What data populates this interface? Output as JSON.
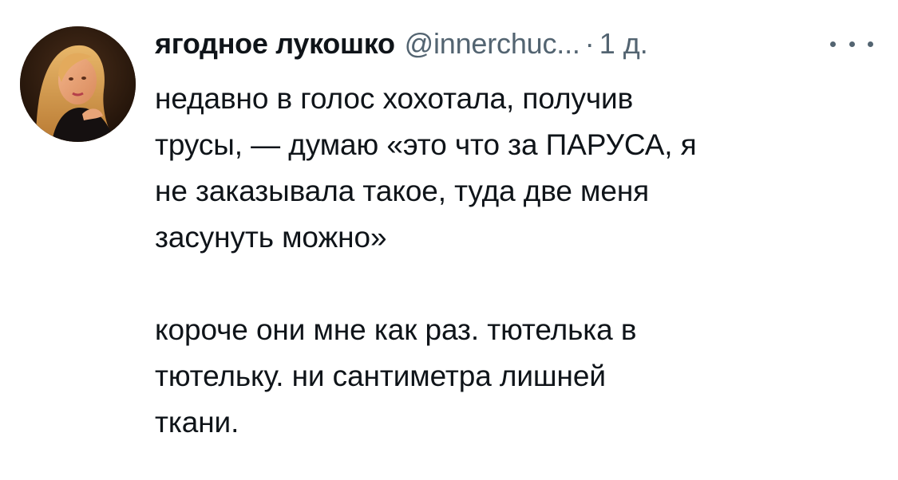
{
  "tweet": {
    "author": {
      "display_name": "ягодное лукошко",
      "handle": "@innerchuc...",
      "avatar_icon": "profile-photo-avatar"
    },
    "separator": "·",
    "time": "1 д.",
    "more_icon": "more-horizontal-icon",
    "paragraphs": [
      "недавно в голос хохотала, получив\nтрусы, — думаю «это что за ПАРУСА, я\nне заказывала такое, туда две меня\nзасунуть можно»",
      "короче они мне как раз. тютелька в\nтютельку. ни сантиметра лишней\nткани."
    ]
  },
  "colors": {
    "text_primary": "#0f1419",
    "text_secondary": "#536471",
    "background": "#ffffff"
  }
}
